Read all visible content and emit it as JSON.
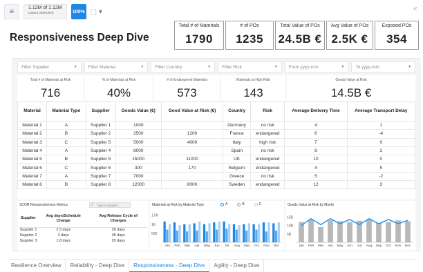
{
  "toolbar": {
    "selection_count": "1.12M of 1.12M",
    "selection_caption": "cases selected",
    "percent": "100%",
    "hamburger_icon": "hamburger-icon",
    "selection_tool_icon": "lasso-select-icon",
    "share_icon": "share-icon"
  },
  "page_title": "Responsiveness Deep Dive",
  "kpis": [
    {
      "label": "Total # of Materials",
      "value": "1790"
    },
    {
      "label": "# of POs",
      "value": "1235"
    },
    {
      "label": "Total Value of POs",
      "value": "24.5B €"
    },
    {
      "label": "Avg Value of POs",
      "value": "2.5K €"
    },
    {
      "label": "Exposed POs",
      "value": "354"
    }
  ],
  "filters": {
    "supplier": "Filter Supplier",
    "material": "Filter Material",
    "country": "Filter Country",
    "risk": "Filter Risk",
    "from": "From yyyy-mm",
    "to": "To yyyy-mm"
  },
  "stats": [
    {
      "label": "Total # of Materials at Risk",
      "value": "716"
    },
    {
      "label": "% of Materials at Risk",
      "value": "40%"
    },
    {
      "label": "# of Endangered Materials",
      "value": "573"
    },
    {
      "label": "Materials at High Risk",
      "value": "143"
    },
    {
      "label": "Goods Value at Risk",
      "value": "14.5B €"
    }
  ],
  "table": {
    "headers": [
      "Material",
      "Material Type",
      "Supplier",
      "Goods Value (€)",
      "Good Value at Risk (€)",
      "Country",
      "Risk",
      "Average Delivery Time",
      "Average Transport Delay"
    ],
    "rows": [
      [
        "Material 1",
        "A",
        "Supplier 1",
        "1000",
        "",
        "Germany",
        "no risk",
        "4",
        "1"
      ],
      [
        "Material 2",
        "B",
        "Supplier 2",
        "2500",
        "1200",
        "France",
        "endangered",
        "6",
        "-4"
      ],
      [
        "Material 3",
        "C",
        "Supplier 5",
        "5000",
        "4000",
        "Italy",
        "high risk",
        "7",
        "0"
      ],
      [
        "Material 4",
        "A",
        "Supplier 4",
        "8000",
        "",
        "Spain",
        "no risk",
        "8",
        "2"
      ],
      [
        "Material 5",
        "B",
        "Supplier 5",
        "15000",
        "11000",
        "UK",
        "endangered",
        "10",
        "0"
      ],
      [
        "Material 6",
        "C",
        "Supplier 6",
        "300",
        "170",
        "Belgium",
        "endangered",
        "4",
        "5"
      ],
      [
        "Material 7",
        "A",
        "Supplier 7",
        "7000",
        "",
        "Greece",
        "no risk",
        "5",
        "-2"
      ],
      [
        "Material 8",
        "B",
        "Supplier 8",
        "12000",
        "8000",
        "Sweden",
        "endangered",
        "12",
        "3"
      ]
    ]
  },
  "scor": {
    "title": "SCOR Responsiveness Metrics",
    "search_placeholder": "Type a Supplier...",
    "headers": [
      "Supplier",
      "Avg days/Schedule Change",
      "Avg Release Cycle of Changes"
    ],
    "rows": [
      [
        "Supplier 1",
        "2.5 days",
        "30 days"
      ],
      [
        "Supplier 2",
        "3 days",
        "45 days"
      ],
      [
        "Supplier 3",
        "1.8 days",
        "20 days"
      ]
    ]
  },
  "chart_data": [
    {
      "type": "bar",
      "title": "Materials at Risk by Material Type",
      "legend": [
        "A",
        "B",
        "C"
      ],
      "legend_placement": "top",
      "categories": [
        "Jan",
        "Feb",
        "Mar",
        "Apr",
        "May",
        "Jun",
        "Jul",
        "Aug",
        "Sep",
        "Oct",
        "Nov",
        "Dec"
      ],
      "yticks": [
        "1.5K",
        "1K",
        "500"
      ],
      "ylim": [
        0,
        1600
      ],
      "series": [
        {
          "name": "A",
          "color": "#1e88e5",
          "values": [
            1150,
            1100,
            1000,
            1050,
            1000,
            1100,
            1150,
            1000,
            1000,
            1000,
            1100,
            1050
          ]
        },
        {
          "name": "B",
          "color": "#5aa9ee",
          "values": [
            700,
            650,
            600,
            650,
            600,
            700,
            750,
            700,
            650,
            700,
            600,
            650
          ]
        },
        {
          "name": "C",
          "color": "#a7d0f5",
          "values": [
            1000,
            950,
            1000,
            1150,
            1050,
            1150,
            1000,
            950,
            1050,
            1000,
            1100,
            1100
          ]
        }
      ]
    },
    {
      "type": "bar",
      "title": "Goods Value at Risk by Month",
      "categories": [
        "Jan",
        "Feb",
        "Mar",
        "Apr",
        "May",
        "Jun",
        "Jul",
        "Aug",
        "Sep",
        "Oct",
        "Nov",
        "Dec"
      ],
      "yticks": [
        "15B",
        "10B",
        "5B"
      ],
      "ylim": [
        0,
        18
      ],
      "bar_color": "#b8b8b8",
      "line_color": "#2196f3",
      "bars": [
        12,
        13.5,
        9,
        13,
        12.5,
        12,
        12.8,
        13.5,
        11.5,
        12,
        13,
        12.5
      ],
      "line": [
        10,
        14,
        10.5,
        14,
        11,
        13.5,
        10.5,
        14,
        11,
        13.5,
        11,
        13
      ]
    }
  ],
  "tabs": [
    "Resilience Overview",
    "Reliability - Deep Dive",
    "Responsiveness - Deep Dive",
    "Agility - Deep Dive"
  ],
  "active_tab": "Responsiveness - Deep Dive"
}
